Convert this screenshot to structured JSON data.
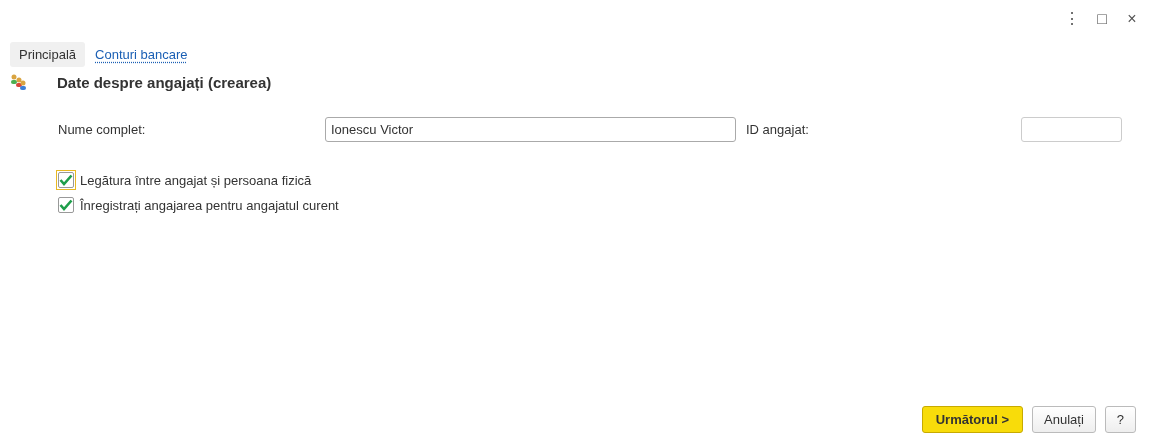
{
  "window_controls": [
    "⋮",
    "□",
    "×"
  ],
  "tabs": [
    {
      "label": "Principală",
      "selected": true
    },
    {
      "label": "Conturi bancare",
      "selected": false
    }
  ],
  "title": "Date despre angajați (crearea)",
  "fields": [
    {
      "label": "Nume complet:",
      "value": "Ionescu Victor"
    },
    {
      "label": "ID angajat:"
    }
  ],
  "checkboxes": [
    {
      "label": "Legătura între angajat și persoana fizică",
      "checked": true,
      "focused": true
    },
    {
      "label": "Înregistrați angajarea pentru angajatul curent",
      "checked": true,
      "focused": false
    }
  ],
  "buttons": [
    {
      "label": "Următorul >",
      "kind": "primary"
    },
    {
      "label": "Anulați",
      "kind": "normal"
    },
    {
      "label": "?",
      "kind": "normal"
    }
  ]
}
